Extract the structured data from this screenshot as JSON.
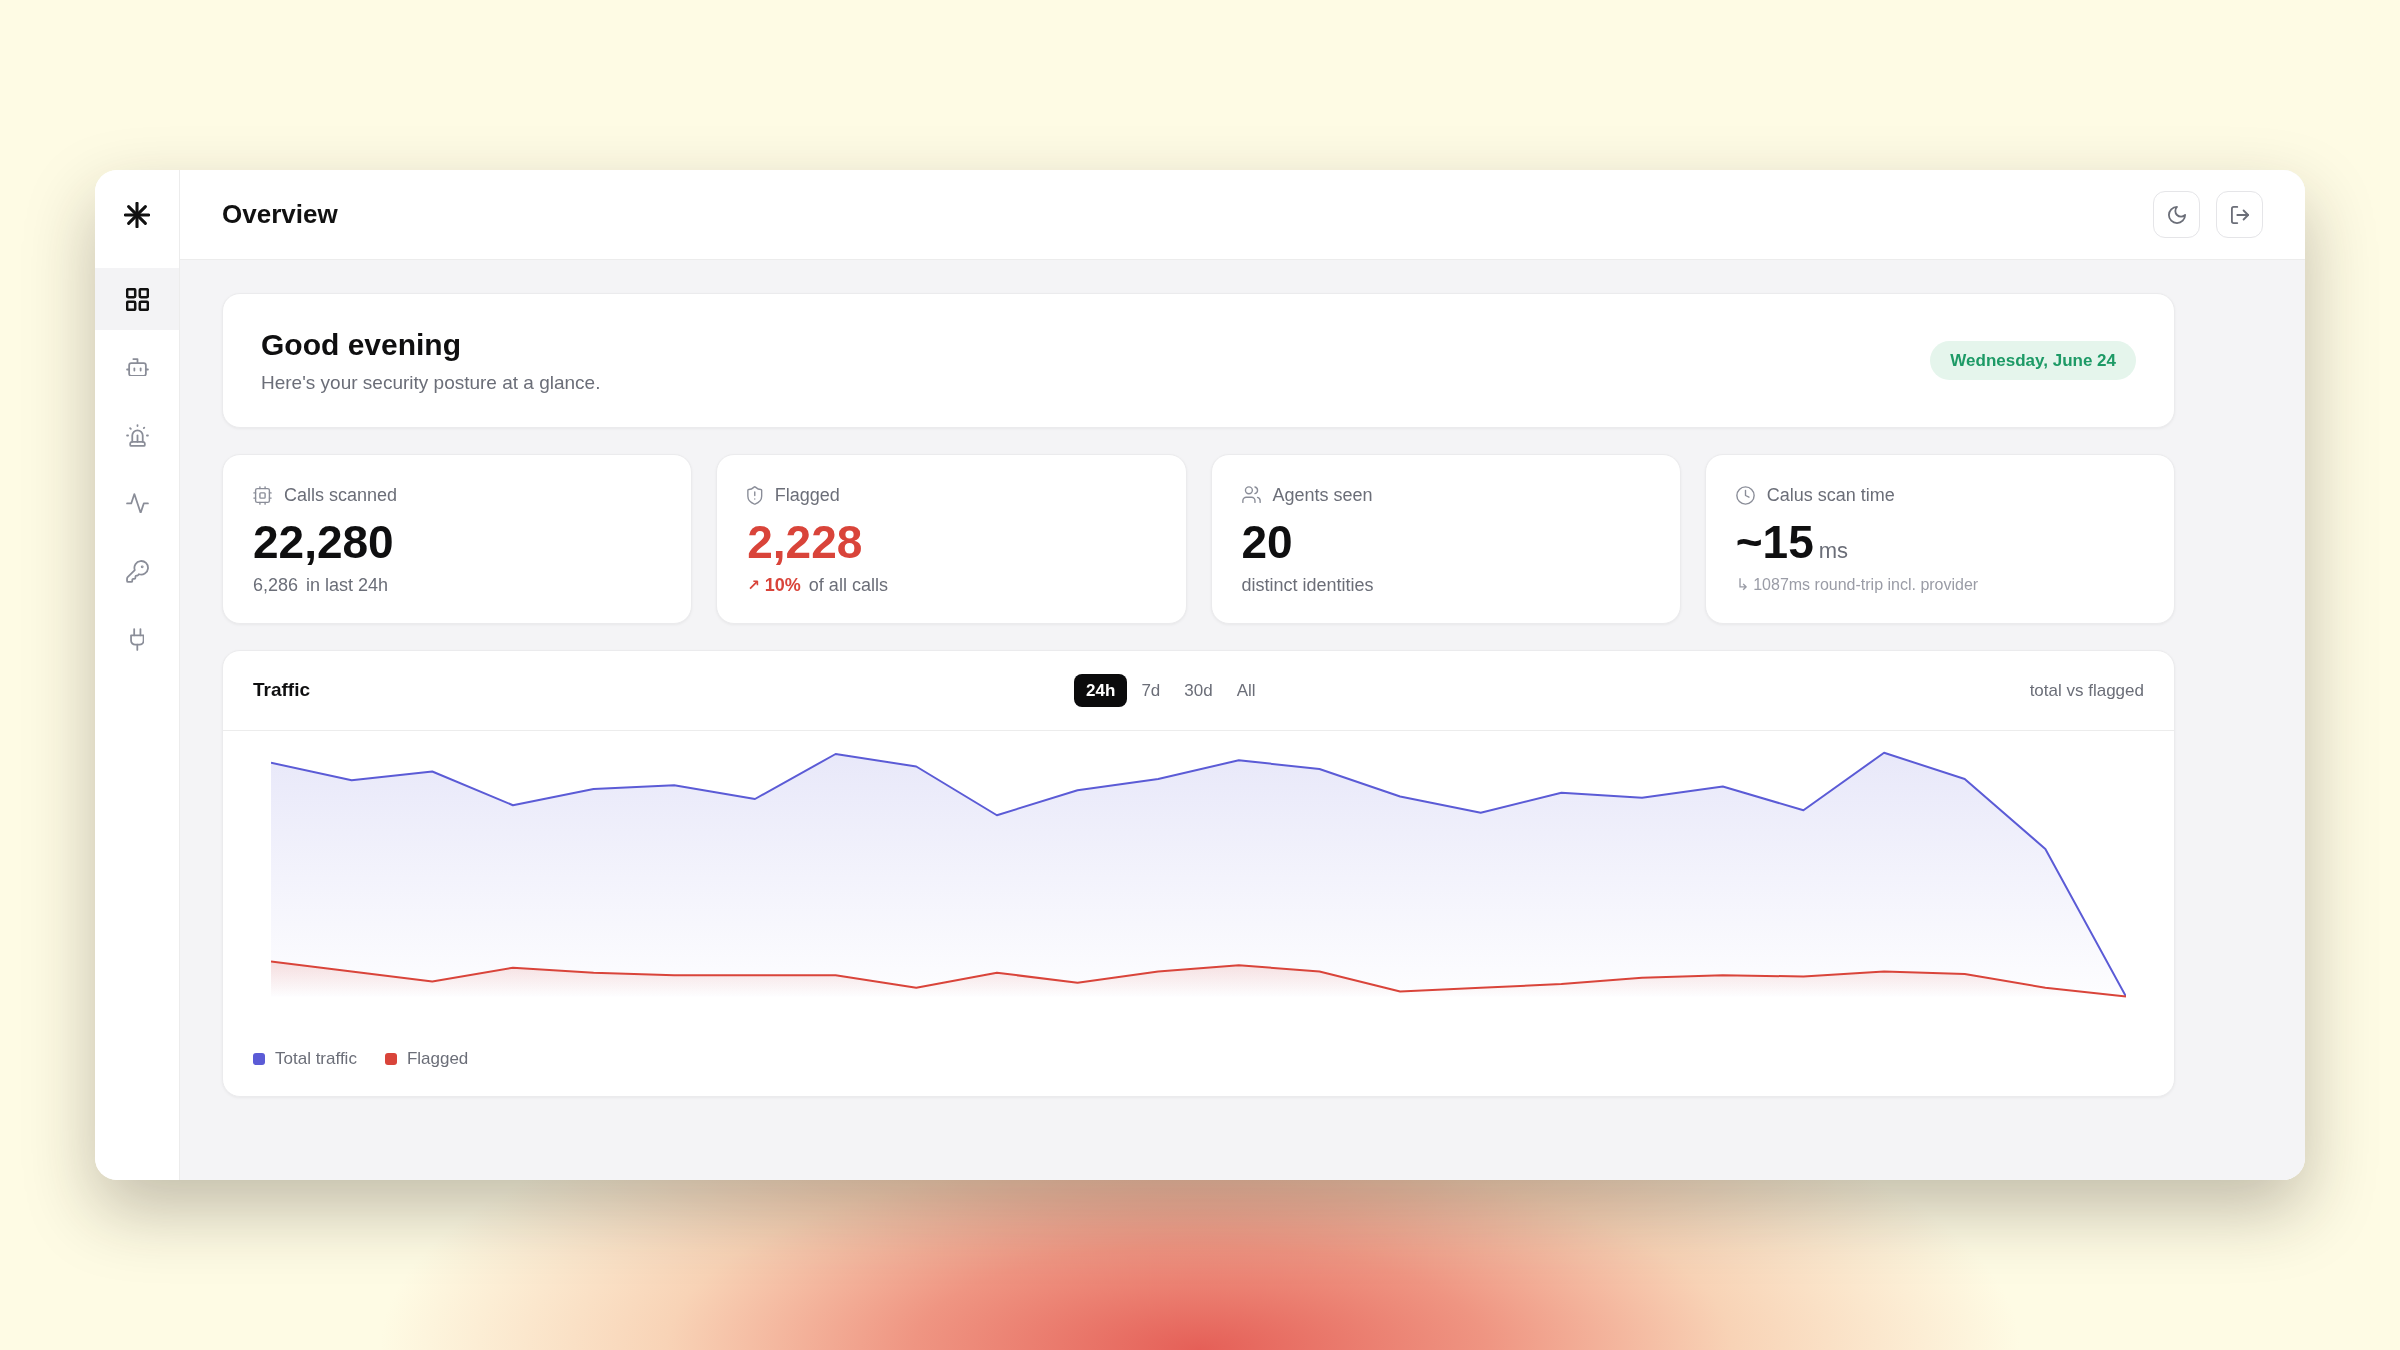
{
  "sidebar": {
    "items": [
      {
        "selected": true
      },
      {
        "selected": false
      },
      {
        "selected": false
      },
      {
        "selected": false
      },
      {
        "selected": false
      },
      {
        "selected": false
      }
    ]
  },
  "header": {
    "title": "Overview"
  },
  "greeting": {
    "title": "Good evening",
    "subtitle": "Here's your security posture at a glance.",
    "date": "Wednesday, June 24"
  },
  "stats": [
    {
      "kind": "count",
      "label": "Calls scanned",
      "value": "22,280",
      "alert": false,
      "detail": "6,286",
      "note": "in last 24h"
    },
    {
      "kind": "count",
      "label": "Flagged",
      "value": "2,228",
      "alert": true,
      "trend": "↗",
      "detail": "10%",
      "note": "of all calls"
    },
    {
      "kind": "count",
      "label": "Agents seen",
      "value": "20",
      "alert": false,
      "note": "distinct identities"
    },
    {
      "kind": "latency",
      "label": "Calus scan time",
      "value": "~15",
      "unit": "ms",
      "note": "↳ 1087ms round-trip incl. provider"
    }
  ],
  "traffic": {
    "title": "Traffic",
    "tabs": [
      {
        "label": "24h",
        "selected": true
      },
      {
        "label": "7d",
        "selected": false
      },
      {
        "label": "30d",
        "selected": false
      },
      {
        "label": "All",
        "selected": false
      }
    ],
    "caption": "total vs flagged",
    "legend": [
      {
        "label": "Total traffic",
        "color": "#5b5bd6"
      },
      {
        "label": "Flagged",
        "color": "#d9443a"
      }
    ]
  }
}
